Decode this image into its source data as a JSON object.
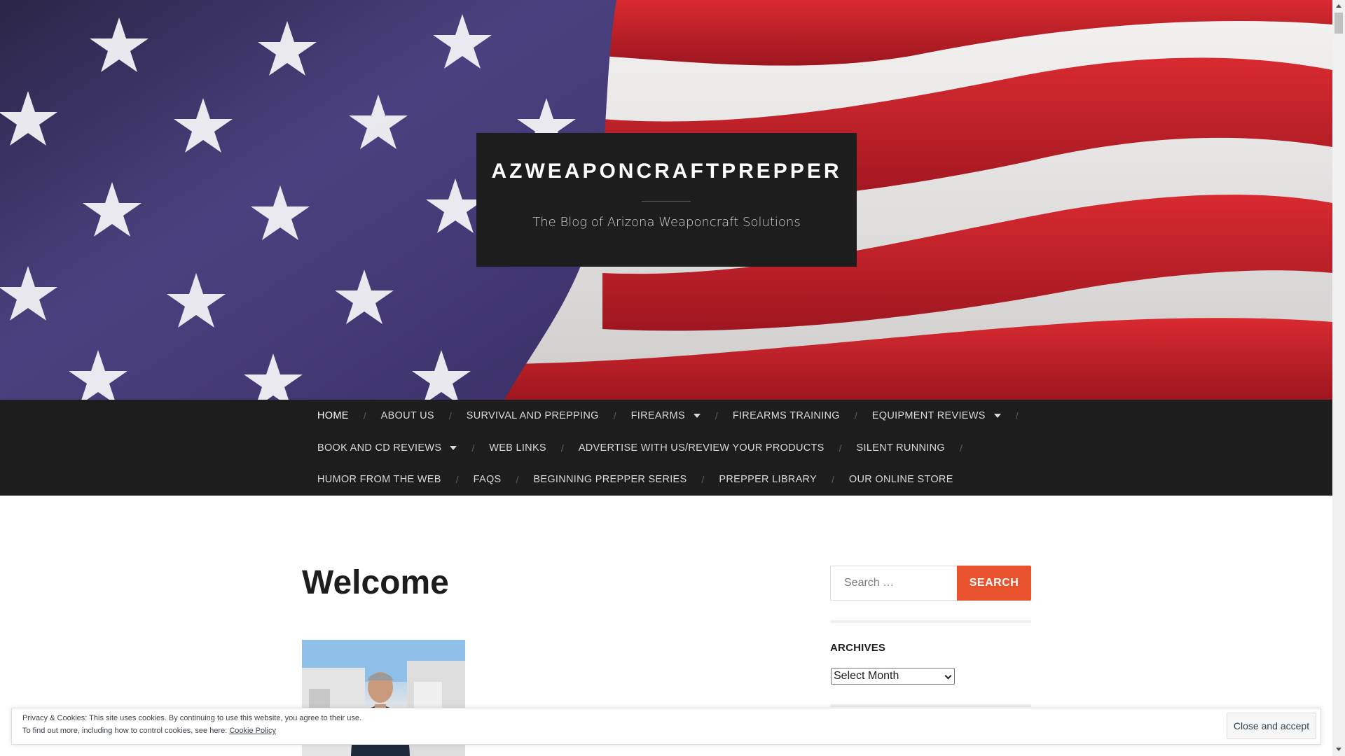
{
  "site": {
    "title": "AZWEAPONCRAFTPREPPER",
    "tagline": "The Blog of Arizona Weaponcraft Solutions"
  },
  "nav": {
    "rows": [
      [
        {
          "label": "HOME",
          "active": true,
          "dropdown": false
        },
        {
          "label": "ABOUT US",
          "dropdown": false
        },
        {
          "label": "SURVIVAL AND PREPPING",
          "dropdown": false
        },
        {
          "label": "FIREARMS",
          "dropdown": true
        },
        {
          "label": "FIREARMS TRAINING",
          "dropdown": false
        },
        {
          "label": "EQUIPMENT REVIEWS",
          "dropdown": true
        }
      ],
      [
        {
          "label": "BOOK AND CD REVIEWS",
          "dropdown": true
        },
        {
          "label": "WEB LINKS",
          "dropdown": false
        },
        {
          "label": "ADVERTISE WITH US/REVIEW YOUR PRODUCTS",
          "dropdown": false
        },
        {
          "label": "SILENT RUNNING",
          "dropdown": false
        }
      ],
      [
        {
          "label": "HUMOR FROM THE WEB",
          "dropdown": false
        },
        {
          "label": "FAQS",
          "dropdown": false
        },
        {
          "label": "BEGINNING PREPPER SERIES",
          "dropdown": false
        },
        {
          "label": "PREPPER LIBRARY",
          "dropdown": false
        },
        {
          "label": "OUR ONLINE STORE",
          "dropdown": false
        }
      ]
    ],
    "separator": "/"
  },
  "main": {
    "post_title": "Welcome"
  },
  "sidebar": {
    "search": {
      "placeholder": "Search …",
      "button_label": "SEARCH"
    },
    "archives": {
      "title": "ARCHIVES",
      "selected": "Select Month"
    }
  },
  "cookie_banner": {
    "line1": "Privacy & Cookies: This site uses cookies. By continuing to use this website, you agree to their use.",
    "line2_prefix": "To find out more, including how to control cookies, see here: ",
    "link_label": "Cookie Policy",
    "button_label": "Close and accept"
  },
  "colors": {
    "accent": "#e8522d",
    "dark": "#1d1d1d",
    "nav_text": "#d9d9d9"
  }
}
